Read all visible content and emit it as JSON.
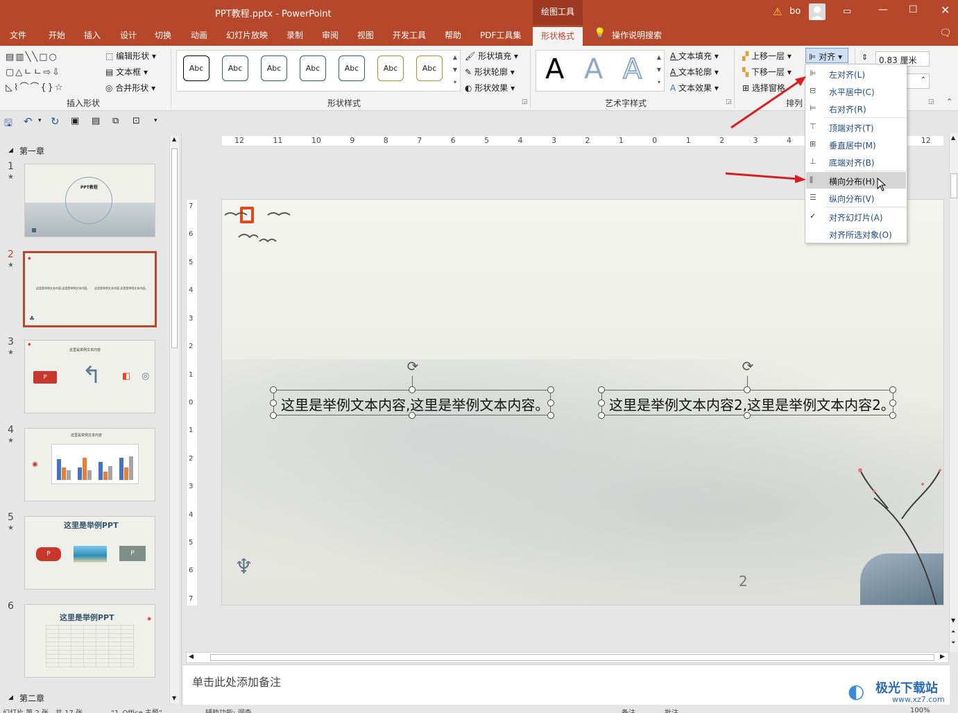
{
  "window": {
    "title": "PPT教程.pptx  -  PowerPoint",
    "context_tab": "绘图工具",
    "user": "bo"
  },
  "tabs": [
    "文件",
    "开始",
    "插入",
    "设计",
    "切换",
    "动画",
    "幻灯片放映",
    "录制",
    "审阅",
    "视图",
    "开发工具",
    "帮助",
    "PDF工具集"
  ],
  "active_tab": "形状格式",
  "search_label": "操作说明搜索",
  "ribbon": {
    "insert_shapes": {
      "edit_shape": "编辑形状",
      "text_box": "文本框",
      "merge_shape": "合并形状",
      "label": "插入形状"
    },
    "shape_styles": {
      "abc": [
        "Abc",
        "Abc",
        "Abc",
        "Abc",
        "Abc",
        "Abc",
        "Abc"
      ],
      "fill": "形状填充",
      "outline": "形状轮廓",
      "effect": "形状效果",
      "label": "形状样式"
    },
    "wordart": {
      "letters": [
        "A",
        "A",
        "A"
      ],
      "fill": "文本填充",
      "outline": "文本轮廓",
      "effect": "文本效果",
      "label": "艺术字样式"
    },
    "arrange": {
      "bring_forward": "上移一层",
      "send_backward": "下移一层",
      "selection_pane": "选择窗格",
      "align": "对齐",
      "label": "排列"
    },
    "size": {
      "height": "0.83 厘米"
    }
  },
  "align_menu": {
    "items": [
      "左对齐(L)",
      "水平居中(C)",
      "右对齐(R)",
      "顶端对齐(T)",
      "垂直居中(M)",
      "底端对齐(B)",
      "横向分布(H)",
      "纵向分布(V)",
      "对齐幻灯片(A)",
      "对齐所选对象(O)"
    ],
    "highlighted": "横向分布(H)"
  },
  "slide_panel": {
    "section1": "第一章",
    "section2": "第二章",
    "thumbs": [
      {
        "num": "1",
        "text": "PPT教程"
      },
      {
        "num": "2",
        "text": "这里是举例文本内容,这里是举例文本内容。"
      },
      {
        "num": "3",
        "text": "这里是举例文本内容"
      },
      {
        "num": "4",
        "text": "这里是举例文本内容"
      },
      {
        "num": "5",
        "text": "这里是举例PPT"
      },
      {
        "num": "6",
        "text": "这里是举例PPT"
      }
    ]
  },
  "ruler": {
    "h": [
      "12",
      "11",
      "10",
      "9",
      "8",
      "7",
      "6",
      "5",
      "4",
      "3",
      "2",
      "1",
      "0",
      "1",
      "2",
      "3",
      "4",
      "5",
      "6",
      "7",
      "12"
    ],
    "v": [
      "7",
      "6",
      "5",
      "4",
      "3",
      "2",
      "1",
      "0",
      "1",
      "2",
      "3",
      "4",
      "5",
      "6",
      "7"
    ]
  },
  "slide": {
    "text1": "这里是举例文本内容,这里是举例文本内容。",
    "text2": "这里是举例文本内容2,这里是举例文本内容2。",
    "page_number": "2"
  },
  "notes_placeholder": "单击此处添加备注",
  "status": {
    "slide_info": "幻灯片 第 2 张，共 17 张",
    "theme": "“1_Office 主题”",
    "accessibility": "辅助功能: 调查",
    "notes": "备注",
    "comments": "批注",
    "zoom": "100%"
  },
  "watermark": {
    "brand": "极光下载站",
    "url": "www.xz7.com"
  },
  "colors": {
    "accent": "#b7472a",
    "link": "#1f4a8a",
    "arrow": "#d81e1e"
  }
}
